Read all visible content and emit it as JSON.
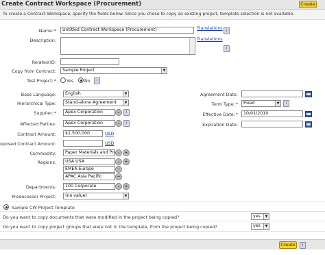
{
  "window": {
    "title": "Create Contract Workspace (Procurement)",
    "create_label": "Create"
  },
  "intro_text": "To create a Contract Workspace, specify the fields below. Since you chose to copy an existing project, template selection is not available.",
  "fields": {
    "name": {
      "label": "Name:",
      "value": "Untitled Contract Workspace (Procurement)",
      "translations": "Translations"
    },
    "description": {
      "label": "Description:",
      "value": "",
      "translations": "Translations"
    },
    "related_id": {
      "label": "Related ID:",
      "value": ""
    },
    "copy_from": {
      "label": "Copy from Contract:",
      "value": "Sample Project"
    },
    "test_project": {
      "label": "Test Project:",
      "yes": "Yes",
      "no": "No",
      "selected": "No"
    },
    "base_language": {
      "label": "Base Language:",
      "value": "English"
    },
    "hierarchical_type": {
      "label": "Hierarchical Type:",
      "value": "Stand-alone Agreement"
    },
    "supplier": {
      "label": "Supplier:",
      "value": "Apex Corporation"
    },
    "affected_parties": {
      "label": "Affected Parties:",
      "value": "Apex Corporation"
    },
    "contract_amount": {
      "label": "Contract Amount:",
      "value": "$1,500,000",
      "currency": "USD"
    },
    "proposed_amount": {
      "label": "Proposed Contract Amount:",
      "value": "",
      "currency": "USD"
    },
    "commodity": {
      "label": "Commodity:",
      "value": "Paper Materials and Pro"
    },
    "regions": {
      "label": "Regions:",
      "values": [
        "USA USA",
        "EMEA Europe",
        "APAC Asia Pacific"
      ]
    },
    "departments": {
      "label": "Departments:",
      "value": "100 Corporate"
    },
    "predecessor": {
      "label": "Predecessor Project:",
      "value": "(no value)"
    },
    "agreement_date": {
      "label": "Agreement Date:",
      "value": ""
    },
    "term_type": {
      "label": "Term Type:",
      "value": "Fixed"
    },
    "effective_date": {
      "label": "Effective Date:",
      "value": "10/01/2010"
    },
    "expiration_date": {
      "label": "Expiration Date:",
      "value": ""
    }
  },
  "template": {
    "label": "Sample CW Project Template"
  },
  "questions": [
    {
      "text": "Do you want to copy documents that were modified in the project being copied?",
      "value": "yes"
    },
    {
      "text": "Do you want to copy project groups that were not in the template, from the project being copied?",
      "value": "yes"
    }
  ],
  "icons": {
    "info": "info-icon",
    "calendar": "calendar-icon",
    "search": "search-circle-icon",
    "add": "add-circle-icon",
    "remove": "remove-circle-icon"
  },
  "colors": {
    "button_bg": "#f2d23c",
    "required": "#cc0000",
    "link": "#1a3fa6"
  }
}
